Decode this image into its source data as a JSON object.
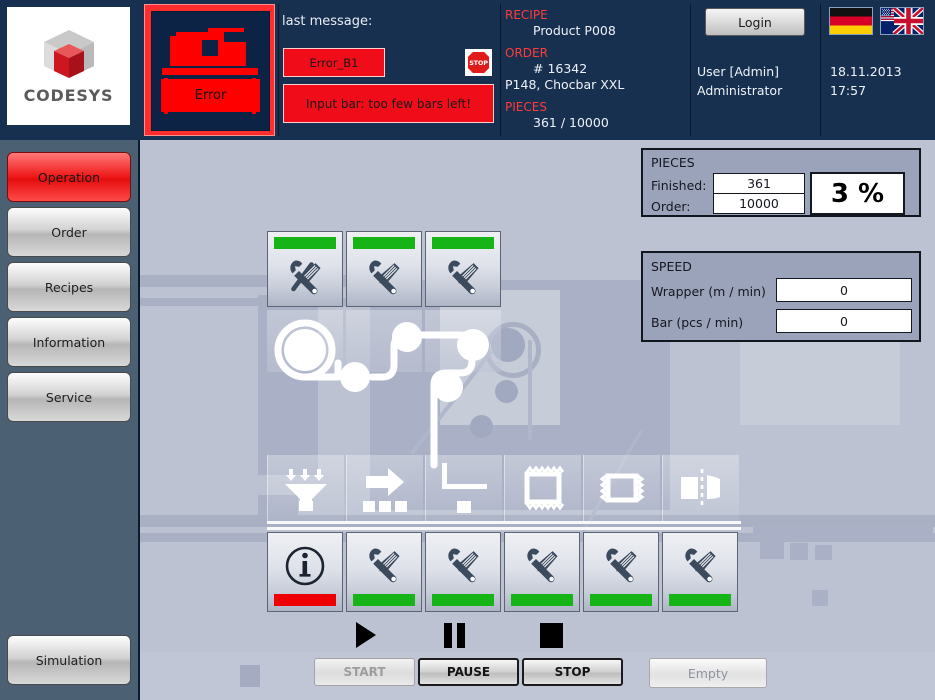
{
  "app": {
    "brand": "CODESYS"
  },
  "header": {
    "error_tile": {
      "label": "Error",
      "icon": "machine-error-icon"
    },
    "last_message": {
      "title": "last message:",
      "code": "Error_B1",
      "text": "Input bar: too few bars left!",
      "stop_icon_label": "STOP"
    },
    "recipe": {
      "key": "RECIPE",
      "value": "Product P008"
    },
    "order": {
      "key": "ORDER",
      "number": "# 16342",
      "description": "P148, Chocbar XXL"
    },
    "pieces": {
      "key": "PIECES",
      "value": "361 / 10000"
    },
    "login_button": "Login",
    "user": {
      "name": "User [Admin]",
      "role": "Administrator"
    },
    "languages": [
      {
        "name": "german-flag",
        "title": "Deutsch"
      },
      {
        "name": "english-flag",
        "title": "English"
      }
    ],
    "datetime": {
      "date": "18.11.2013",
      "time": "17:57"
    }
  },
  "sidebar": {
    "items": [
      {
        "label": "Operation",
        "active": true
      },
      {
        "label": "Order",
        "active": false
      },
      {
        "label": "Recipes",
        "active": false
      },
      {
        "label": "Information",
        "active": false
      },
      {
        "label": "Service",
        "active": false
      }
    ],
    "footer": {
      "label": "Simulation"
    }
  },
  "panels": {
    "pieces": {
      "title": "PIECES",
      "finished_label": "Finished:",
      "finished_value": "361",
      "order_label": "Order:",
      "order_value": "10000",
      "percent": "3 %"
    },
    "speed": {
      "title": "SPEED",
      "wrapper_label": "Wrapper (m / min)",
      "wrapper_value": "0",
      "bar_label": "Bar (pcs / min)",
      "bar_value": "0"
    }
  },
  "stations": {
    "top_row": [
      {
        "name": "station-1",
        "status": "green",
        "icon": "tools-icon"
      },
      {
        "name": "station-2",
        "status": "green",
        "icon": "tools-icon"
      },
      {
        "name": "station-3",
        "status": "green",
        "icon": "tools-icon"
      }
    ],
    "bottom_row": [
      {
        "name": "station-info",
        "status": "red",
        "icon": "info-icon"
      },
      {
        "name": "station-4",
        "status": "green",
        "icon": "tools-icon"
      },
      {
        "name": "station-5",
        "status": "green",
        "icon": "tools-icon"
      },
      {
        "name": "station-6",
        "status": "green",
        "icon": "tools-icon"
      },
      {
        "name": "station-7",
        "status": "green",
        "icon": "tools-icon"
      },
      {
        "name": "station-8",
        "status": "green",
        "icon": "tools-icon"
      }
    ],
    "process_icons": [
      {
        "name": "funnel-feed-icon"
      },
      {
        "name": "transfer-arrow-icon"
      },
      {
        "name": "corner-transport-icon"
      },
      {
        "name": "wrap-flow-icon"
      },
      {
        "name": "seal-pack-icon"
      },
      {
        "name": "cut-separate-icon"
      }
    ]
  },
  "controls": {
    "play_icon": "play-icon",
    "pause_icon": "pause-icon",
    "stop_icon": "stop-icon",
    "start": {
      "label": "START",
      "enabled": false
    },
    "pause": {
      "label": "PAUSE",
      "enabled": true
    },
    "stop": {
      "label": "STOP",
      "enabled": true
    },
    "empty": {
      "label": "Empty",
      "enabled": false
    }
  },
  "colors": {
    "header_bg": "#17304f",
    "sidebar_bg": "#4c6074",
    "main_bg": "#bcc2d2",
    "accent_red": "#ee0000",
    "status_green": "#16b416",
    "panel_bg": "#9ba3bb"
  }
}
